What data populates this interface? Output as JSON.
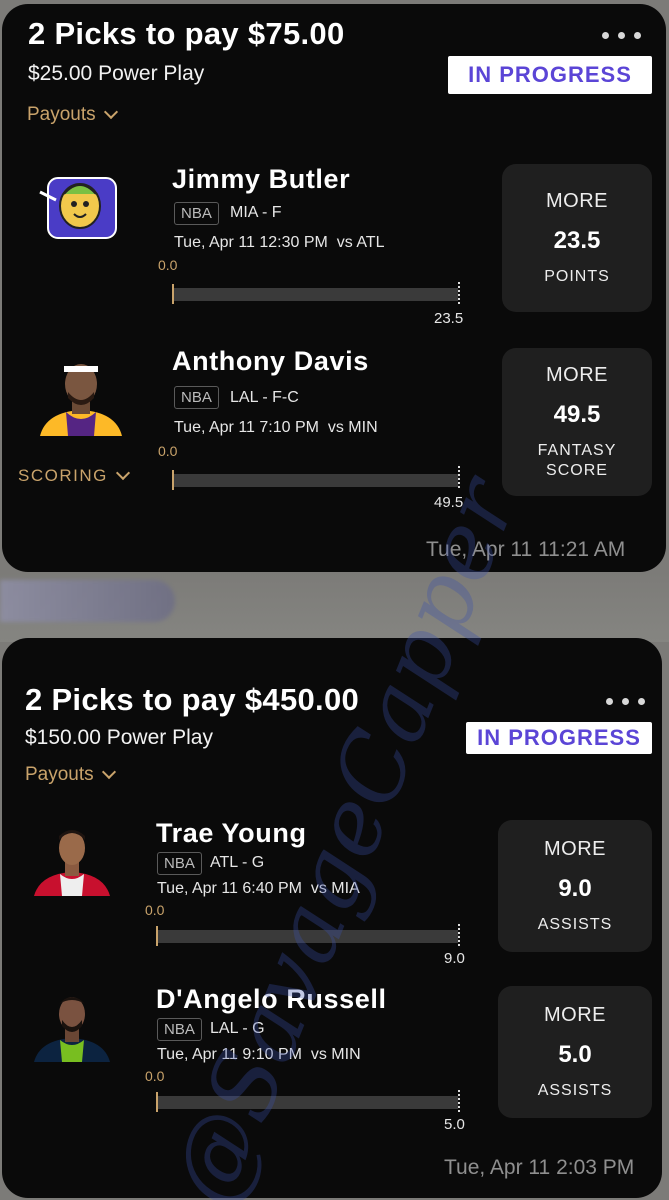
{
  "colors": {
    "accent": "#c9a36b",
    "status_text": "#5b45d6",
    "card_bg": "#0a0a0a",
    "pick_bg": "#1f1f1f"
  },
  "entries": [
    {
      "title": "2 Picks to pay $75.00",
      "subtitle": "$25.00 Power Play",
      "payouts_label": "Payouts",
      "status": "IN PROGRESS",
      "more_icon": "more-dots-icon",
      "timestamp": "Tue, Apr 11 11:21 AM",
      "scoring_label": "SCORING",
      "players": [
        {
          "name": "Jimmy Butler",
          "league": "NBA",
          "team_pos": "MIA - F",
          "game": "Tue, Apr 11 12:30 PM  vs ATL",
          "current": "0.0",
          "progress": 0,
          "target": "23.5",
          "direction": "MORE",
          "line": "23.5",
          "stat": "POINTS",
          "avatar_icon": "taco-mascot-icon"
        },
        {
          "name": "Anthony Davis",
          "league": "NBA",
          "team_pos": "LAL - F-C",
          "game": "Tue, Apr 11 7:10 PM  vs MIN",
          "current": "0.0",
          "progress": 0,
          "target": "49.5",
          "direction": "MORE",
          "line": "49.5",
          "stat": "FANTASY SCORE",
          "avatar_icon": "player-headshot-icon"
        }
      ]
    },
    {
      "title": "2 Picks to pay $450.00",
      "subtitle": "$150.00 Power Play",
      "payouts_label": "Payouts",
      "status": "IN PROGRESS",
      "more_icon": "more-dots-icon",
      "timestamp": "Tue, Apr 11 2:03 PM",
      "players": [
        {
          "name": "Trae Young",
          "league": "NBA",
          "team_pos": "ATL - G",
          "game": "Tue, Apr 11 6:40 PM  vs MIA",
          "current": "0.0",
          "progress": 0,
          "target": "9.0",
          "direction": "MORE",
          "line": "9.0",
          "stat": "ASSISTS",
          "avatar_icon": "player-headshot-icon"
        },
        {
          "name": "D'Angelo Russell",
          "league": "NBA",
          "team_pos": "LAL - G",
          "game": "Tue, Apr 11 9:10 PM  vs MIN",
          "current": "0.0",
          "progress": 0,
          "target": "5.0",
          "direction": "MORE",
          "line": "5.0",
          "stat": "ASSISTS",
          "avatar_icon": "player-headshot-icon"
        }
      ]
    }
  ],
  "watermark": "@SavageCapper"
}
